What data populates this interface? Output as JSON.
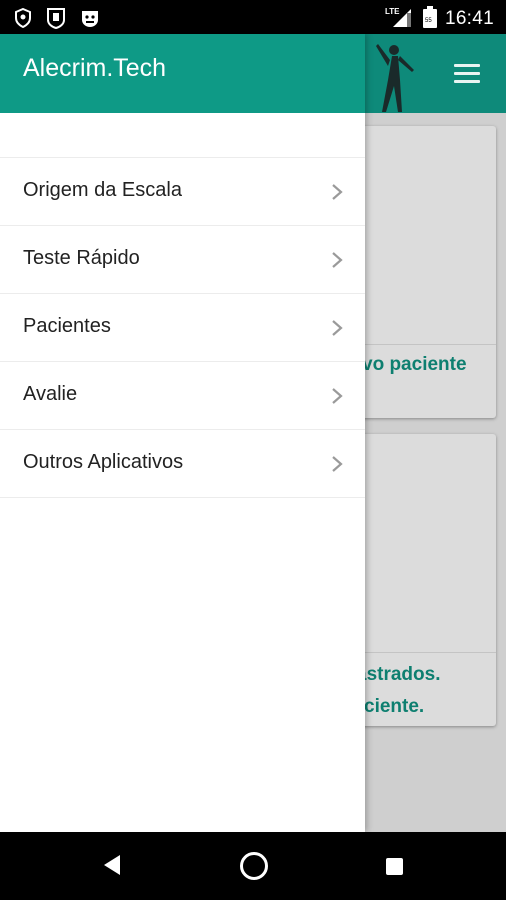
{
  "status_bar": {
    "time": "16:41",
    "network": "LTE",
    "icons": [
      "shield-icon",
      "badge-icon",
      "face-icon",
      "lte-signal-icon",
      "battery-icon"
    ]
  },
  "drawer": {
    "title": "Alecrim.Tech",
    "items": [
      {
        "label": "Origem da Escala"
      },
      {
        "label": "Teste Rápido"
      },
      {
        "label": "Pacientes"
      },
      {
        "label": "Avalie"
      },
      {
        "label": "Outros Aplicativos"
      }
    ]
  },
  "background": {
    "card1_link": "vo paciente",
    "card2_line1": "astrados.",
    "card2_line2": "ciente."
  },
  "colors": {
    "header": "#0e9a86",
    "accent_text": "#0e7f70"
  }
}
